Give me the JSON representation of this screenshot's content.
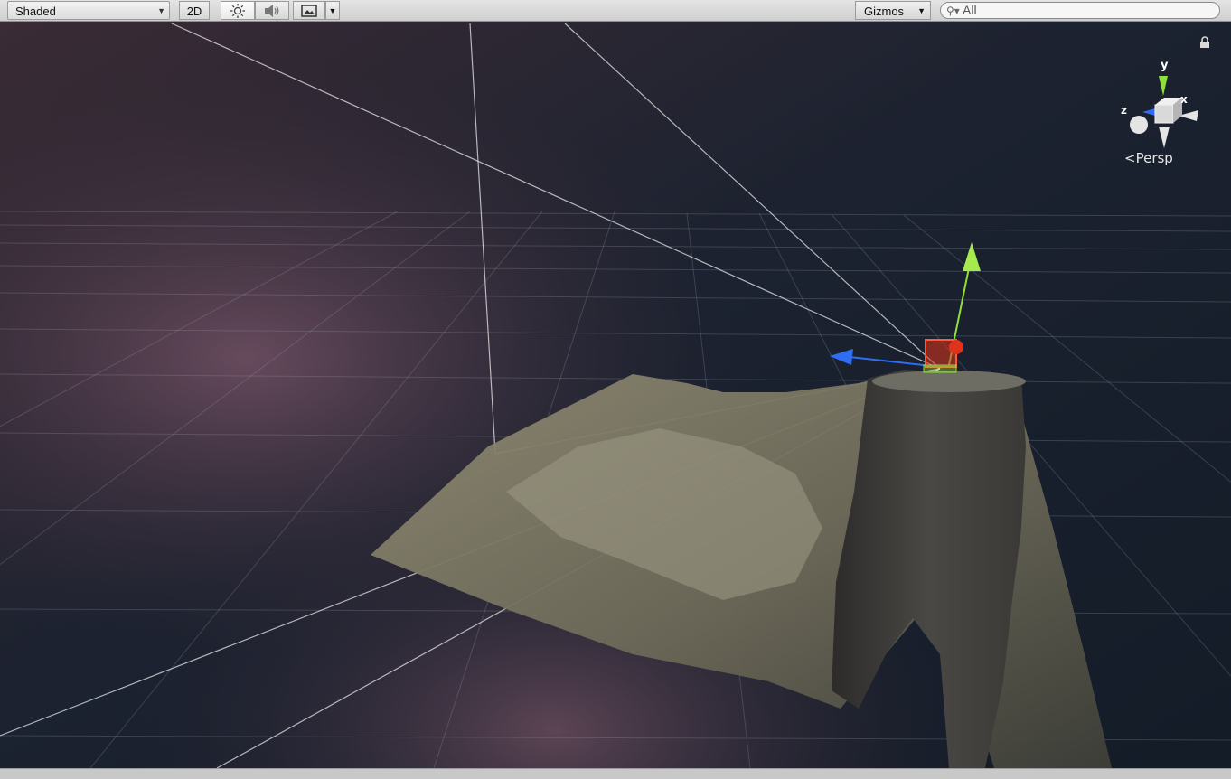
{
  "toolbar": {
    "shading_mode": "Shaded",
    "mode_2d": "2D",
    "lighting_icon": "sun-icon",
    "audio_icon": "speaker-icon",
    "effects_icon": "image-icon",
    "gizmos_label": "Gizmos",
    "search_placeholder": "All"
  },
  "scene_gizmo": {
    "axis_y": "y",
    "axis_x": "x",
    "axis_z": "z",
    "projection": "Persp"
  },
  "colors": {
    "x_axis": "#e0331e",
    "y_axis": "#8fe03a",
    "z_axis": "#2f6ef0"
  },
  "statusbar": {
    "message": ""
  }
}
